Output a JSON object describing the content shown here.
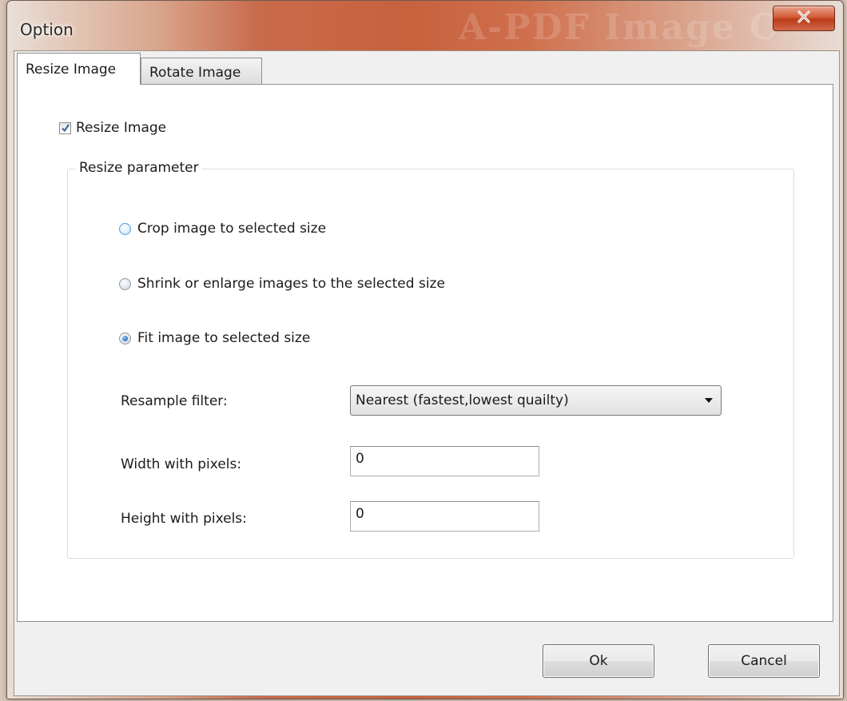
{
  "window": {
    "title": "Option",
    "ghost_title": "A-PDF Image Converter",
    "close_glyph": "X"
  },
  "tabs": [
    {
      "label": "Resize Image",
      "active": true
    },
    {
      "label": "Rotate Image",
      "active": false
    }
  ],
  "resize": {
    "checkbox_label": "Resize Image",
    "checked": true,
    "group_title": "Resize parameter",
    "options": [
      {
        "label": "Crop image to selected size",
        "selected": false
      },
      {
        "label": "Shrink or enlarge images to the selected size",
        "selected": false
      },
      {
        "label": "Fit image to selected size",
        "selected": true
      }
    ],
    "filter_label": "Resample filter:",
    "filter_value": "Nearest (fastest,lowest quailty)",
    "width_label": "Width with pixels:",
    "width_value": "0",
    "height_label": "Height with pixels:",
    "height_value": "0"
  },
  "buttons": {
    "ok": "Ok",
    "cancel": "Cancel"
  },
  "colors": {
    "titlebar_accent": "#c7613e",
    "close_button": "#c8492a"
  }
}
